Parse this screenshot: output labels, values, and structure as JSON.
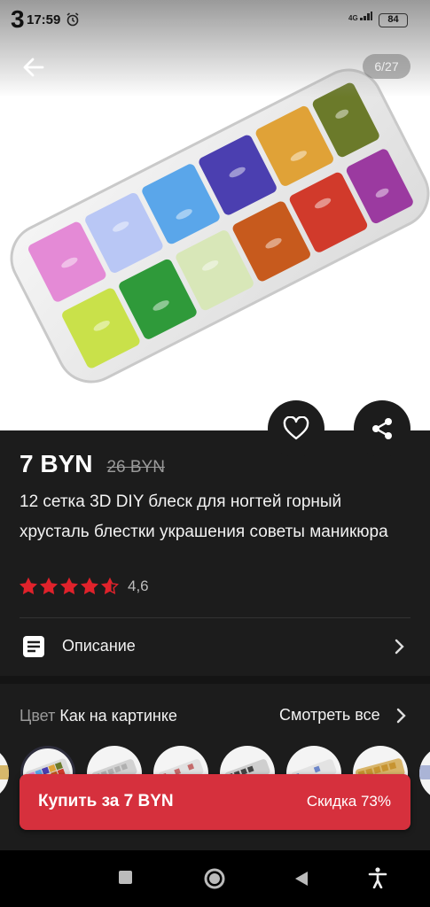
{
  "status_bar": {
    "notification_digit": "3",
    "time": "17:59",
    "network": "4G",
    "battery": "84"
  },
  "gallery": {
    "counter": "6/27"
  },
  "product": {
    "price": "7 BYN",
    "old_price": "26 BYN",
    "title": "12 сетка 3D DIY блеск для ногтей горный хрусталь блестки украшения советы маникюра",
    "rating": 4.6,
    "rating_text": "4,6",
    "stars_total": 5
  },
  "description": {
    "label": "Описание"
  },
  "variant": {
    "label": "Цвет",
    "value": "Как на картинке",
    "see_all": "Смотреть все"
  },
  "buy_bar": {
    "label": "Купить за 7 BYN",
    "discount": "Скидка 73%"
  },
  "colors": {
    "accent": "#d6303d",
    "star": "#e0222b",
    "background": "#1c1c1c"
  },
  "icons": {
    "back": "arrow-left-icon",
    "favorite": "heart-icon",
    "share": "share-icon",
    "description": "document-icon",
    "chevron": "chevron-right-icon",
    "nav_recents": "square-icon",
    "nav_home": "circle-icon",
    "nav_back": "triangle-icon",
    "accessibility": "accessibility-icon"
  }
}
